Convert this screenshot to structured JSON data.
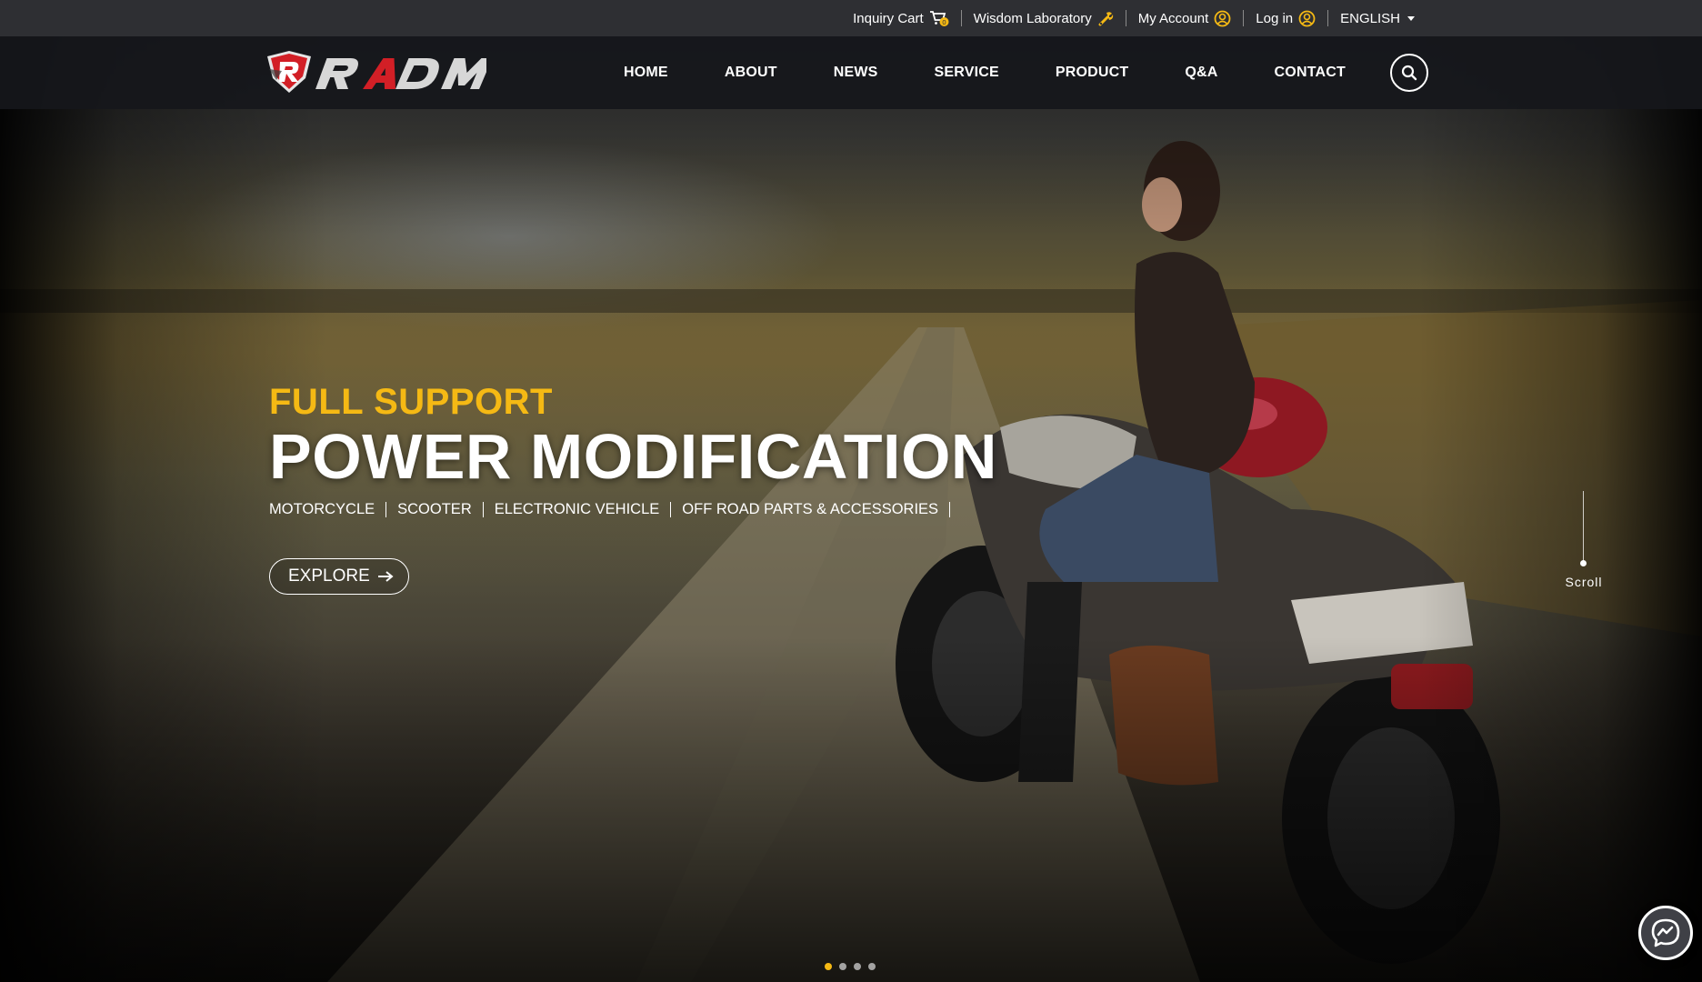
{
  "topbar": {
    "inquiry_cart": {
      "label": "Inquiry Cart",
      "icon": "cart-icon",
      "badge": "0"
    },
    "wisdom_lab": {
      "label": "Wisdom Laboratory",
      "icon": "wrench-icon"
    },
    "my_account": {
      "label": "My Account",
      "icon": "user-circle-icon"
    },
    "login": {
      "label": "Log in",
      "icon": "user-circle-icon"
    },
    "language": {
      "label": "ENGLISH",
      "icon": "caret-down-icon"
    }
  },
  "logo": {
    "text": "RADM"
  },
  "nav": {
    "items": [
      {
        "label": "HOME"
      },
      {
        "label": "ABOUT"
      },
      {
        "label": "NEWS"
      },
      {
        "label": "SERVICE"
      },
      {
        "label": "PRODUCT"
      },
      {
        "label": "Q&A"
      },
      {
        "label": "CONTACT"
      }
    ],
    "search_icon": "search-icon"
  },
  "hero": {
    "eyebrow": "FULL SUPPORT",
    "headline": "POWER MODIFICATION",
    "categories": [
      "MOTORCYCLE",
      "SCOOTER",
      "ELECTRONIC VEHICLE",
      "OFF ROAD PARTS & ACCESSORIES"
    ],
    "cta_label": "EXPLORE",
    "scroll_label": "Scroll"
  },
  "carousel": {
    "total": 4,
    "active": 1
  },
  "colors": {
    "accent": "#f5b914",
    "topbar_bg": "#2e2f33",
    "nav_bg": "#16171b",
    "logo_red": "#d21f26"
  },
  "messenger": {
    "icon": "messenger-icon"
  }
}
